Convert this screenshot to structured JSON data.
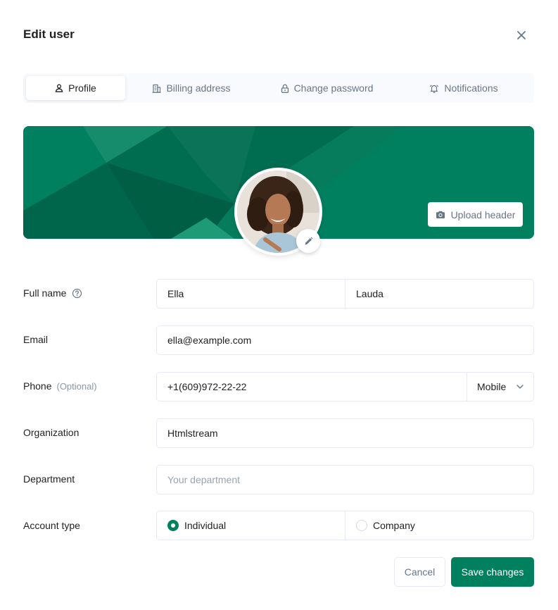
{
  "modal": {
    "title": "Edit user"
  },
  "tabs": [
    {
      "label": "Profile",
      "icon": "person-icon",
      "active": true
    },
    {
      "label": "Billing address",
      "icon": "building-icon",
      "active": false
    },
    {
      "label": "Change password",
      "icon": "lock-icon",
      "active": false
    },
    {
      "label": "Notifications",
      "icon": "bell-icon",
      "active": false
    }
  ],
  "header": {
    "upload_label": "Upload header"
  },
  "form": {
    "full_name": {
      "label": "Full name",
      "first": "Ella",
      "last": "Lauda"
    },
    "email": {
      "label": "Email",
      "value": "ella@example.com"
    },
    "phone": {
      "label": "Phone",
      "optional": "(Optional)",
      "value": "+1(609)972-22-22",
      "type": "Mobile"
    },
    "organization": {
      "label": "Organization",
      "value": "Htmlstream"
    },
    "department": {
      "label": "Department",
      "value": "",
      "placeholder": "Your department"
    },
    "account_type": {
      "label": "Account type",
      "options": [
        {
          "label": "Individual",
          "checked": true
        },
        {
          "label": "Company",
          "checked": false
        }
      ]
    }
  },
  "actions": {
    "cancel": "Cancel",
    "save": "Save changes"
  },
  "colors": {
    "brand": "#00805f",
    "text": "#1e2022",
    "muted": "#677788",
    "border": "#e7eaf3"
  }
}
